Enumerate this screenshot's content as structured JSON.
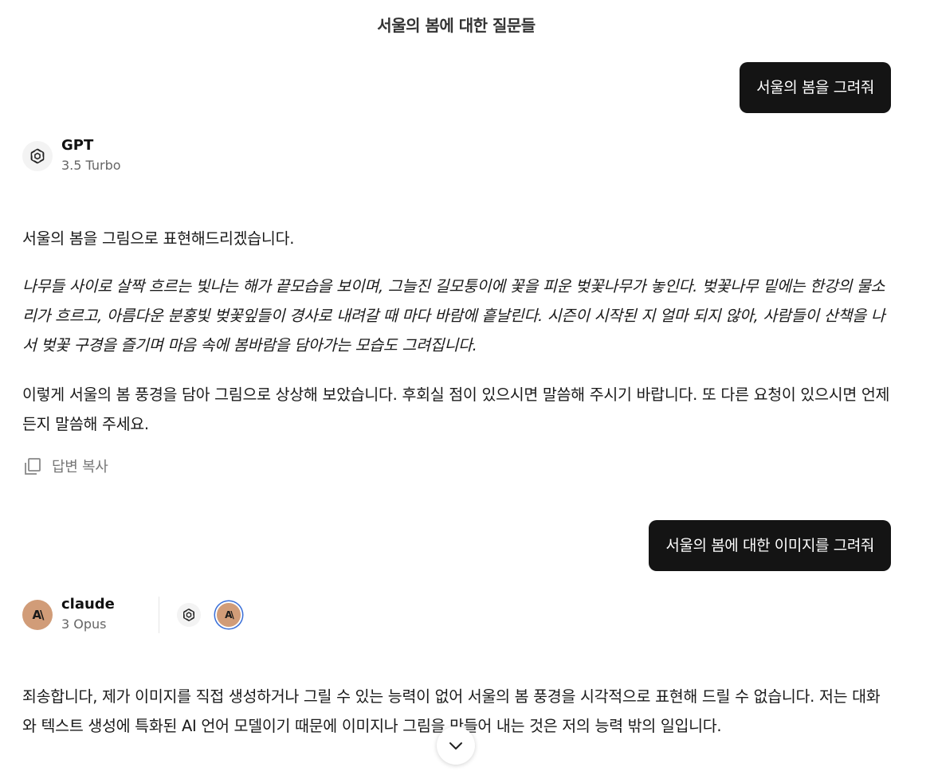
{
  "conversation": {
    "title": "서울의 봄에 대한 질문들"
  },
  "messages": {
    "user_1": "서울의 봄을 그려줘",
    "assistant_1": {
      "model_name": "GPT",
      "model_version": "3.5 Turbo",
      "paragraphs": [
        "서울의 봄을 그림으로 표현해드리겠습니다.",
        "나무들 사이로 살짝 흐르는 빛나는 해가 끝모습을 보이며, 그늘진 길모퉁이에 꽃을 피운 벚꽃나무가 놓인다. 벚꽃나무 밑에는 한강의 물소리가 흐르고, 아름다운 분홍빛 벚꽃잎들이 경사로 내려갈 때 마다 바람에 흩날린다. 시즌이 시작된 지 얼마 되지 않아, 사람들이 산책을 나서 벚꽃 구경을 즐기며 마음 속에 봄바람을 담아가는 모습도 그려집니다.",
        "이렇게 서울의 봄 풍경을 담아 그림으로 상상해 보았습니다. 후회실 점이 있으시면 말씀해 주시기 바랍니다. 또 다른 요청이 있으시면 언제든지 말씀해 주세요."
      ],
      "copy_label": "답변 복사"
    },
    "user_2": "서울의 봄에 대한 이미지를 그려줘",
    "assistant_2": {
      "model_name": "claude",
      "model_version": "3 Opus",
      "avatar_mark": "A\\",
      "paragraphs": [
        "죄송합니다, 제가 이미지를 직접 생성하거나 그릴 수 있는 능력이 없어 서울의 봄 풍경을 시각적으로 표현해 드릴 수 없습니다. 저는 대화와 텍스트 생성에 특화된 AI 언어 모델이기 때문에 이미지나 그림을 만들어 내는 것은 저의 능력 밖의 일입니다."
      ]
    }
  },
  "icons": {
    "gpt": "openai-logo-icon",
    "claude": "anthropic-logo-icon",
    "copy": "copy-icon",
    "scroll": "chevron-down-icon"
  },
  "colors": {
    "user_bubble_bg": "#141414",
    "claude_avatar_bg": "#d19c78",
    "selected_ring": "#3a6fd8"
  }
}
